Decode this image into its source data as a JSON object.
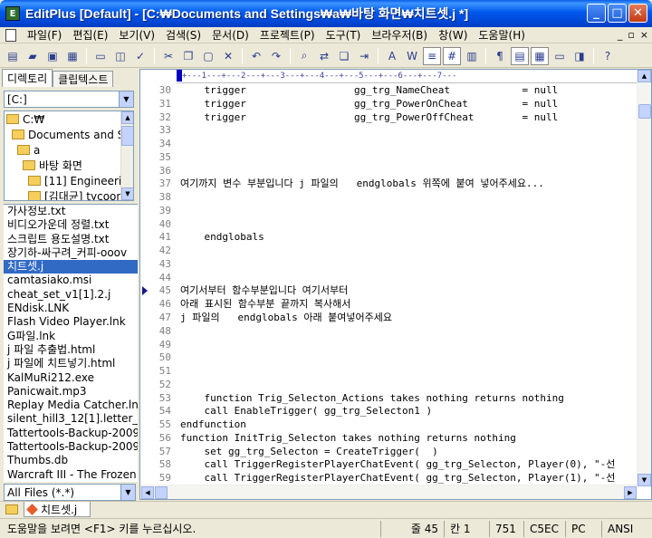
{
  "window": {
    "title": "EditPlus [Default] - [C:₩Documents and Settings₩a₩바탕 화면₩치트셋.j *]",
    "minimize": "_",
    "maximize": "□",
    "close": "✕"
  },
  "menu": {
    "items": [
      "파일(F)",
      "편집(E)",
      "보기(V)",
      "검색(S)",
      "문서(D)",
      "프로젝트(P)",
      "도구(T)",
      "브라우저(B)",
      "창(W)",
      "도움말(H)"
    ],
    "mdi": [
      "_",
      "▫",
      "×"
    ]
  },
  "toolbar": {
    "buttons": [
      {
        "icon": "new-file-icon",
        "glyph": "▤"
      },
      {
        "icon": "open-icon",
        "glyph": "▰"
      },
      {
        "icon": "save-icon",
        "glyph": "▣"
      },
      {
        "icon": "save-all-icon",
        "glyph": "▦"
      },
      {
        "sep": true
      },
      {
        "icon": "print-icon",
        "glyph": "▭"
      },
      {
        "icon": "print-preview-icon",
        "glyph": "◫"
      },
      {
        "icon": "spell-check-icon",
        "glyph": "✓"
      },
      {
        "sep": true
      },
      {
        "icon": "cut-icon",
        "glyph": "✂"
      },
      {
        "icon": "copy-icon",
        "glyph": "❐"
      },
      {
        "icon": "paste-icon",
        "glyph": "▢"
      },
      {
        "icon": "delete-icon",
        "glyph": "✕"
      },
      {
        "sep": true
      },
      {
        "icon": "undo-icon",
        "glyph": "↶"
      },
      {
        "icon": "redo-icon",
        "glyph": "↷"
      },
      {
        "sep": true
      },
      {
        "icon": "find-icon",
        "glyph": "⌕"
      },
      {
        "icon": "replace-icon",
        "glyph": "⇄"
      },
      {
        "icon": "find-in-files-icon",
        "glyph": "❏"
      },
      {
        "icon": "goto-icon",
        "glyph": "⇥"
      },
      {
        "sep": true
      },
      {
        "icon": "font-icon",
        "glyph": "A"
      },
      {
        "icon": "word-wrap-icon",
        "glyph": "W"
      },
      {
        "icon": "ruler-icon",
        "glyph": "≡",
        "on": true
      },
      {
        "icon": "line-number-icon",
        "glyph": "#",
        "on": true
      },
      {
        "icon": "column-select-icon",
        "glyph": "▥"
      },
      {
        "sep": true
      },
      {
        "icon": "show-spaces-icon",
        "glyph": "¶"
      },
      {
        "icon": "cliptext-icon",
        "glyph": "▤",
        "on": true
      },
      {
        "icon": "directory-window-icon",
        "glyph": "▦",
        "on": true
      },
      {
        "icon": "output-window-icon",
        "glyph": "▭"
      },
      {
        "icon": "browser-icon",
        "glyph": "◨"
      },
      {
        "sep": true
      },
      {
        "icon": "help-icon",
        "glyph": "?"
      }
    ]
  },
  "left_panel": {
    "tabs": [
      "디렉토리",
      "클립텍스트"
    ],
    "drive": "[C:]",
    "tree": [
      {
        "label": "C:₩",
        "indent": 0
      },
      {
        "label": "Documents and Se",
        "indent": 1
      },
      {
        "label": "a",
        "indent": 2
      },
      {
        "label": "바탕 화면",
        "indent": 3
      },
      {
        "label": "[11] Engineering",
        "indent": 4
      },
      {
        "label": "[김대균] tycoon",
        "indent": 4
      }
    ],
    "files": [
      "가사정보.txt",
      "비디오가운데 정렬.txt",
      "스크립트 용도설명.txt",
      "장기하-싸구려_커피-ooov",
      "치트셋.j",
      "camtasiako.msi",
      "cheat_set_v1[1].2.j",
      "ENdisk.LNK",
      "Flash Video Player.lnk",
      "G파일.lnk",
      "j 파일 추출법.html",
      "j 파일에 치트넣기.html",
      "KalMuRi212.exe",
      "Panicwait.mp3",
      "Replay Media Catcher.lnk",
      "silent_hill3_12[1].letter_-_",
      "Tattertools-Backup-20090",
      "Tattertools-Backup-20090",
      "Thumbs.db",
      "Warcraft III - The Frozen T"
    ],
    "selected_file_index": 4,
    "filter": "All Files (*.*)"
  },
  "editor": {
    "ruler": "+---1---+---2---+---3---+---4---+---5---+---6---+---7---",
    "bookmark_line": 45,
    "lines": [
      {
        "n": "30",
        "t": "    trigger                  gg_trg_NameCheat            = null"
      },
      {
        "n": "31",
        "t": "    trigger                  gg_trg_PowerOnCheat         = null"
      },
      {
        "n": "32",
        "t": "    trigger                  gg_trg_PowerOffCheat        = null"
      },
      {
        "n": "33",
        "t": ""
      },
      {
        "n": "34",
        "t": ""
      },
      {
        "n": "35",
        "t": ""
      },
      {
        "n": "36",
        "t": ""
      },
      {
        "n": "37",
        "t": "여기까지 변수 부분입니다 j 파일의   endglobals 위쪽에 붙여 넣어주세요..."
      },
      {
        "n": "38",
        "t": ""
      },
      {
        "n": "39",
        "t": ""
      },
      {
        "n": "40",
        "t": ""
      },
      {
        "n": "41",
        "t": "    endglobals"
      },
      {
        "n": "42",
        "t": ""
      },
      {
        "n": "43",
        "t": ""
      },
      {
        "n": "44",
        "t": ""
      },
      {
        "n": "45",
        "t": "여기서부터 함수부분입니다 여기서부터"
      },
      {
        "n": "46",
        "t": "아래 표시된 함수부분 끝까지 복사해서"
      },
      {
        "n": "47",
        "t": "j 파일의   endglobals 아래 붙여넣어주세요"
      },
      {
        "n": "48",
        "t": ""
      },
      {
        "n": "49",
        "t": ""
      },
      {
        "n": "50",
        "t": ""
      },
      {
        "n": "51",
        "t": ""
      },
      {
        "n": "52",
        "t": ""
      },
      {
        "n": "53",
        "t": "    function Trig_Selecton_Actions takes nothing returns nothing"
      },
      {
        "n": "54",
        "t": "    call EnableTrigger( gg_trg_Selecton1 )"
      },
      {
        "n": "55",
        "t": "endfunction"
      },
      {
        "n": "56",
        "t": "function InitTrig_Selecton takes nothing returns nothing"
      },
      {
        "n": "57",
        "t": "    set gg_trg_Selecton = CreateTrigger(  )"
      },
      {
        "n": "58",
        "t": "    call TriggerRegisterPlayerChatEvent( gg_trg_Selecton, Player(0), \"-선"
      },
      {
        "n": "59",
        "t": "    call TriggerRegisterPlayerChatEvent( gg_trg_Selecton, Player(1), \"-선"
      }
    ]
  },
  "doc_tabs": [
    "치트셋.j"
  ],
  "status": {
    "help": "도움말을 보려면 <F1> 키를 누르십시오.",
    "line": "줄 45",
    "col": "칸 1",
    "lines_total": "751",
    "code": "C5EC",
    "eol": "PC",
    "encoding": "ANSI"
  },
  "colors": {
    "title_bar": "#0058ee",
    "selection": "#316ac5",
    "line_number": "#808080",
    "ruler": "#4040a0"
  }
}
